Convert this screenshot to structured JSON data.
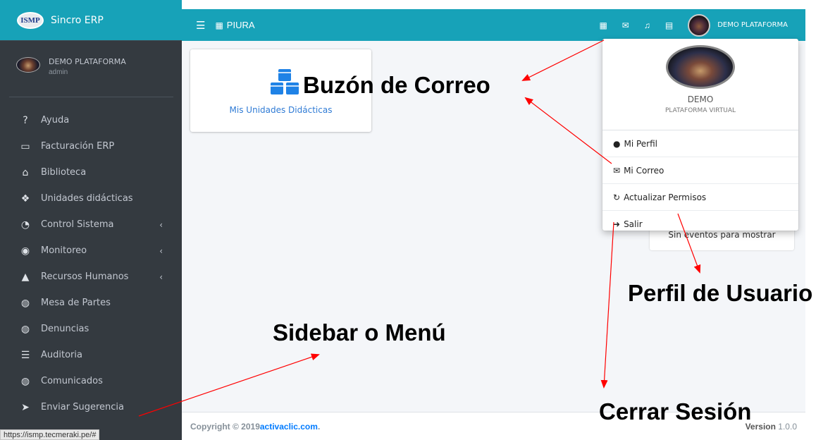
{
  "brand": {
    "logo_text": "ISMP",
    "name": "Sincro ERP"
  },
  "user_panel": {
    "name": "DEMO PLATAFORMA",
    "role": "admin"
  },
  "sidebar": {
    "items": [
      {
        "label": "Ayuda",
        "icon": "question-circle-icon",
        "has_submenu": false
      },
      {
        "label": "Facturación ERP",
        "icon": "money-bill-icon",
        "has_submenu": false
      },
      {
        "label": "Biblioteca",
        "icon": "university-icon",
        "has_submenu": false
      },
      {
        "label": "Unidades didácticas",
        "icon": "cubes-icon",
        "has_submenu": false
      },
      {
        "label": "Control Sistema",
        "icon": "tachometer-icon",
        "has_submenu": true
      },
      {
        "label": "Monitoreo",
        "icon": "eye-icon",
        "has_submenu": true
      },
      {
        "label": "Recursos Humanos",
        "icon": "graduation-cap-icon",
        "has_submenu": true
      },
      {
        "label": "Mesa de Partes",
        "icon": "globe-icon",
        "has_submenu": false
      },
      {
        "label": "Denuncias",
        "icon": "globe-icon",
        "has_submenu": false
      },
      {
        "label": "Auditoria",
        "icon": "list-icon",
        "has_submenu": false
      },
      {
        "label": "Comunicados",
        "icon": "globe-icon",
        "has_submenu": false
      },
      {
        "label": "Enviar Sugerencia",
        "icon": "paper-plane-icon",
        "has_submenu": false
      }
    ]
  },
  "status_url": "https://ismp.tecmeraki.pe/#",
  "topbar": {
    "location": "PIURA",
    "user_name": "DEMO PLATAFORMA"
  },
  "main": {
    "card_label": "Mis Unidades Didácticas",
    "events_text": "Sin eventos para mostrar"
  },
  "dropdown": {
    "name": "DEMO",
    "subtitle": "PLATAFORMA VIRTUAL",
    "items": [
      {
        "label": "Mi Perfil",
        "icon": "user-icon"
      },
      {
        "label": "Mi Correo",
        "icon": "envelope-icon"
      },
      {
        "label": "Actualizar Permisos",
        "icon": "sync-icon"
      },
      {
        "label": "Salir",
        "icon": "sign-out-icon"
      }
    ]
  },
  "footer": {
    "copyright": "Copyright © 2019 ",
    "company": "activaclic.com",
    "suffix": ".",
    "version_label": "Version",
    "version_number": "1.0.0"
  },
  "annotations": {
    "mailbox": "Buzón de Correo",
    "profile": "Perfil de Usuario",
    "sidebar": "Sidebar o Menú",
    "logout": "Cerrar Sesión"
  },
  "colors": {
    "accent": "#17a2b8",
    "sidebar_bg": "#343a40",
    "arrow": "#ff0000",
    "link": "#007bff"
  }
}
